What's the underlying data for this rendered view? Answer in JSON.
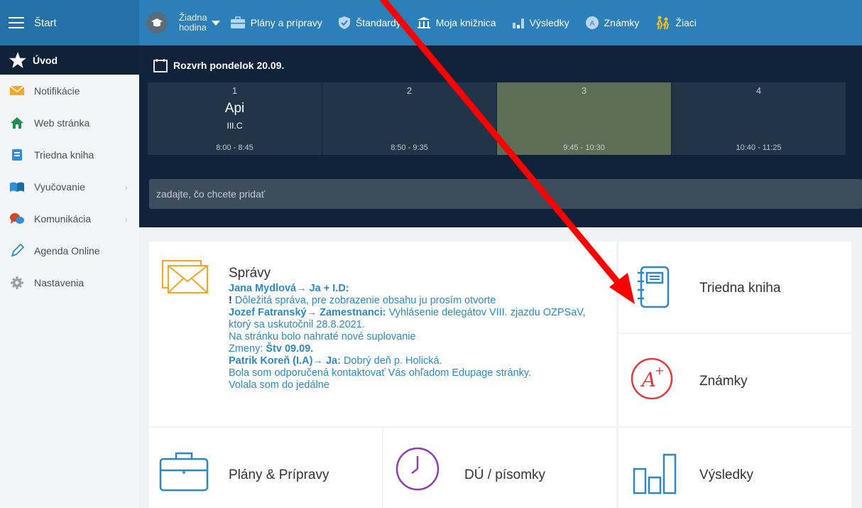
{
  "topbar": {
    "title": "Štart",
    "lesson": {
      "line1": "Žiadna",
      "line2": "hodina"
    },
    "nav": [
      {
        "label": "Plány a prípravy",
        "icon": "briefcase-icon"
      },
      {
        "label": "Štandardy",
        "icon": "shield-check-icon"
      },
      {
        "label": "Moja knižnica",
        "icon": "library-icon"
      },
      {
        "label": "Výsledky",
        "icon": "bar-chart-icon"
      },
      {
        "label": "Známky",
        "icon": "grade-icon"
      },
      {
        "label": "Žiaci",
        "icon": "students-icon"
      }
    ]
  },
  "sidebar": {
    "active": {
      "label": "Úvod",
      "icon": "star-icon"
    },
    "items": [
      {
        "label": "Notifikácie",
        "icon": "envelope-icon"
      },
      {
        "label": "Web stránka",
        "icon": "home-icon"
      },
      {
        "label": "Triedna kniha",
        "icon": "book-icon"
      },
      {
        "label": "Vyučovanie",
        "icon": "open-book-icon",
        "chevron": "›"
      },
      {
        "label": "Komunikácia",
        "icon": "chat-icon",
        "chevron": "›"
      },
      {
        "label": "Agenda Online",
        "icon": "pen-icon"
      },
      {
        "label": "Nastavenia",
        "icon": "gear-icon"
      }
    ]
  },
  "timetable": {
    "heading": "Rozvrh pondelok 20.09.",
    "periods": [
      {
        "num": "1",
        "subject": "Api",
        "class": "III.C",
        "time": "8:00 - 8:45"
      },
      {
        "num": "2",
        "subject": "",
        "class": "",
        "time": "8:50 - 9:35"
      },
      {
        "num": "3",
        "subject": "",
        "class": "",
        "time": "9:45 - 10:30"
      },
      {
        "num": "4",
        "subject": "",
        "class": "",
        "time": "10:40 - 11:25"
      }
    ],
    "add_placeholder": "zadajte, čo chcete pridať"
  },
  "messages": {
    "title": "Správy",
    "m1_sender": "Jana Mydlová→ Ja + I.D:",
    "m1_text": "Dôležitá správa, pre zobrazenie obsahu ju prosím otvorte",
    "m2_sender": "Jozef Fatranský→ Zamestnanci:",
    "m2_text": "Vyhlásenie delegátov VIII. zjazdu OZPSaV, ktorý sa uskutočnil 28.8.2021.",
    "m3_text": "Na stránku bolo nahraté nové suplovanie",
    "m3_changes_label": "Zmeny:",
    "m3_changes_value": "Štv 09.09.",
    "m4_sender": "Patrik Koreň (I.A)→ Ja:",
    "m4_text": "Dobrý deň p. Holická.",
    "m4_more": "Bola som odporučená kontaktovať Vás ohľadom Edupage stránky.",
    "m4_cut": "Volala som do jedálne"
  },
  "tiles": {
    "triedna_kniha": "Triedna kniha",
    "znamky": "Známky",
    "plany": "Plány & Prípravy",
    "du": "DÚ / písomky",
    "vysledky": "Výsledky"
  },
  "colors": {
    "topbar": "#2c7fb8",
    "dark_bg": "#10233a",
    "current_period": "#5d6e56",
    "link_blue": "#2c89c9",
    "annotation_arrow": "#ff0000"
  }
}
